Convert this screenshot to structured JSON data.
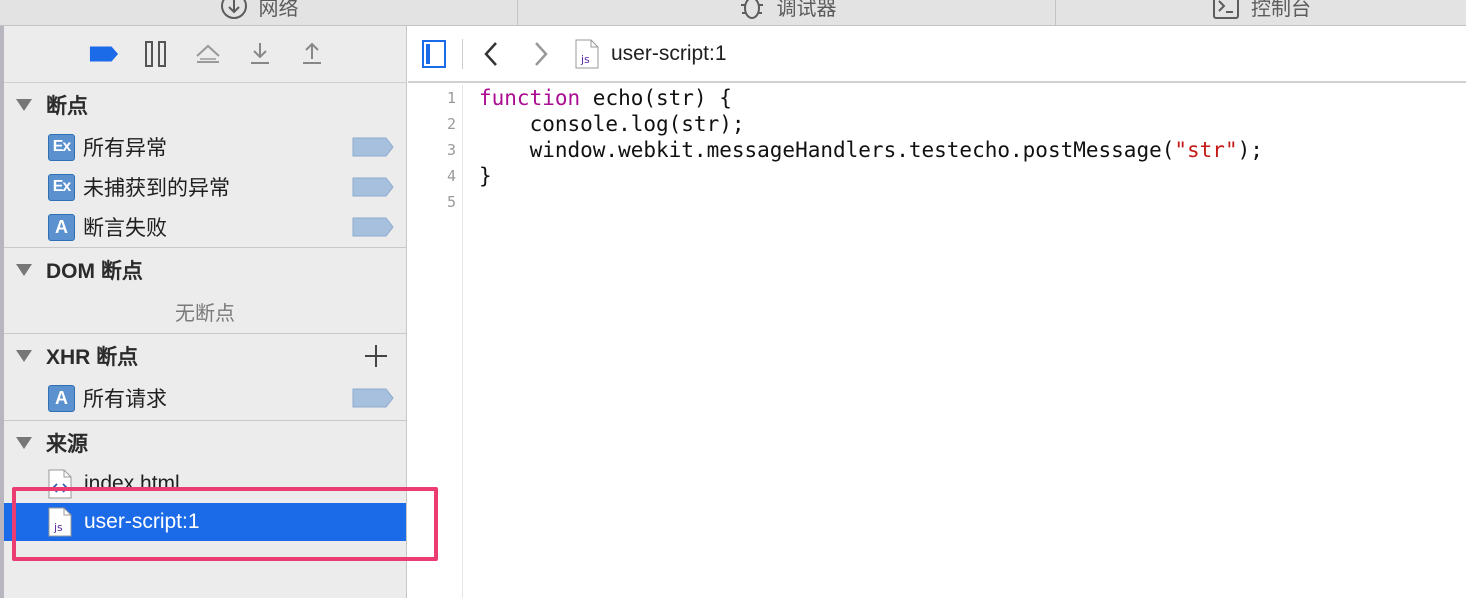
{
  "tabs": [
    {
      "label": "网络",
      "icon": "network-icon"
    },
    {
      "label": "调试器",
      "icon": "bug-icon"
    },
    {
      "label": "控制台",
      "icon": "console-icon"
    }
  ],
  "sidebar": {
    "sections": {
      "breakpoints": {
        "title": "断点",
        "items": [
          {
            "badge": "Ex",
            "label": "所有异常"
          },
          {
            "badge": "Ex",
            "label": "未捕获到的异常"
          },
          {
            "badge": "A",
            "label": "断言失败"
          }
        ]
      },
      "dom": {
        "title": "DOM 断点",
        "empty_text": "无断点"
      },
      "xhr": {
        "title": "XHR 断点",
        "items": [
          {
            "badge": "A",
            "label": "所有请求"
          }
        ]
      },
      "sources": {
        "title": "来源",
        "files": [
          {
            "label": "index.html",
            "icon": "html-file-icon"
          },
          {
            "label": "user-script:1",
            "icon": "js-file-icon",
            "selected": true
          }
        ]
      }
    }
  },
  "editor": {
    "breadcrumb": "user-script:1",
    "line_numbers": [
      "1",
      "2",
      "3",
      "4",
      "5"
    ],
    "code": {
      "l1_kw": "function",
      "l1_rest": " echo(str) {",
      "l2": "    console.log(str);",
      "l3_pre": "    window.webkit.messageHandlers.testecho.postMessage(",
      "l3_str": "\"str\"",
      "l3_post": ");",
      "l4": "}",
      "l5": ""
    }
  },
  "colors": {
    "accent": "#1b6ae8",
    "badge": "#5b91cf",
    "keyword": "#aa0d91",
    "string": "#c41a16",
    "annotation": "#ec3d73"
  }
}
